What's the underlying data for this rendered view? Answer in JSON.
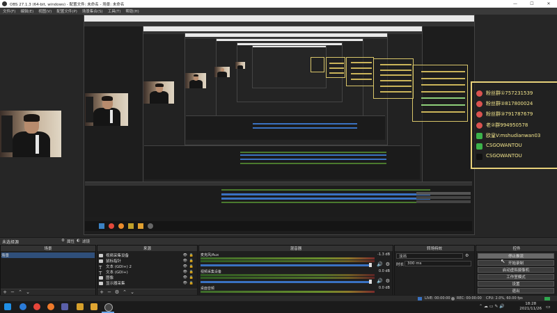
{
  "window": {
    "title": "OBS 27.1.3 (64-bit, windows) - 配置文件: 未命名 - 场景: 未命名",
    "controls": [
      "—",
      "☐",
      "✕"
    ]
  },
  "menu": [
    "文件(F)",
    "编辑(E)",
    "视图(V)",
    "配置文件(P)",
    "场景集合(S)",
    "工具(T)",
    "帮助(H)"
  ],
  "preview": {
    "fan_box": {
      "lines": [
        {
          "icon": "penguin-icon",
          "color": "#d9534f",
          "text": "粉丝群①757231539"
        },
        {
          "icon": "penguin-icon",
          "color": "#d9534f",
          "text": "粉丝群②817800024"
        },
        {
          "icon": "penguin-icon",
          "color": "#d9534f",
          "text": "粉丝群③791787679"
        },
        {
          "icon": "penguin-icon",
          "color": "#d9534f",
          "text": "老②群994950578"
        },
        {
          "icon": "wechat-icon",
          "color": "#3cb34a",
          "text": "欧皇V:mshudianwan03"
        },
        {
          "icon": "wechat-icon",
          "color": "#3cb34a",
          "text": "CSGOWANTOU"
        },
        {
          "icon": "tiktok-icon",
          "color": "#222222",
          "text": "CSGOWANTOU"
        }
      ]
    }
  },
  "scene_bar": {
    "label": "未选择源",
    "properties": "属性",
    "filters": "滤镜"
  },
  "docks": {
    "scenes": {
      "title": "场景",
      "items": [
        "场景"
      ]
    },
    "sources": {
      "title": "来源",
      "items": [
        {
          "label": "视频采集设备",
          "icon": "camera-icon"
        },
        {
          "label": "鼠标指针",
          "icon": "image-icon"
        },
        {
          "label": "文本 (GDI+) 2",
          "icon": "text-icon"
        },
        {
          "label": "文本 (GDI+)",
          "icon": "text-icon"
        },
        {
          "label": "图像",
          "icon": "image-icon"
        },
        {
          "label": "显示器采集",
          "icon": "monitor-icon"
        }
      ]
    },
    "mixer": {
      "title": "混音器",
      "channels": [
        {
          "name": "麦克风/Aux",
          "db": "-1.3 dB"
        },
        {
          "name": "视频采集设备",
          "db": "0.0 dB"
        },
        {
          "name": "桌面音频",
          "db": "0.0 dB"
        }
      ]
    },
    "transitions": {
      "title": "转场特效",
      "type": "淡出",
      "duration_label": "时长",
      "duration": "300 ms"
    },
    "controls": {
      "title": "控件",
      "buttons": [
        "停止推流",
        "开始录制",
        "启动虚拟摄像机",
        "工作室模式",
        "设置",
        "退出"
      ]
    }
  },
  "status": {
    "live": "LIVE: 00:00:00",
    "rec": "REC: 00:00:00",
    "cpu": "CPU: 2.0%, 60.00 fps"
  },
  "taskbar": {
    "time": "18:28",
    "date": "2021/11/26"
  }
}
